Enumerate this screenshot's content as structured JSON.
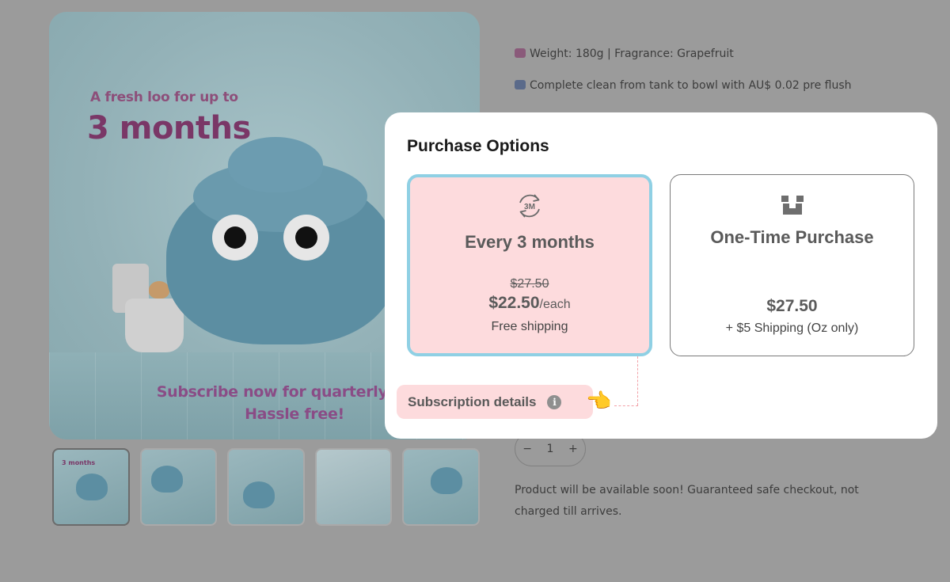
{
  "hero": {
    "pre_title": "A fresh loo for up to",
    "big_title": "3 months",
    "bottom_line1": "Subscribe now for quarterly deliv",
    "bottom_line2": "Hassle free!"
  },
  "thumbnails": {
    "first_caption": "3 months"
  },
  "product": {
    "spec_weight": "Weight: 180g | Fragrance: Grapefruit",
    "spec_clean": "Complete clean from tank to bowl with AU$ 0.02 pre flush",
    "quantity": "1",
    "qty_minus": "−",
    "qty_plus": "+",
    "availability": "Product will be available soon! Guaranteed safe checkout, not charged till arrives."
  },
  "purchase_options": {
    "title": "Purchase Options",
    "subscription": {
      "icon": "refresh-3m-icon",
      "icon_text": "3M",
      "name": "Every 3 months",
      "old_price": "$27.50",
      "price": "$22.50",
      "per": "/each",
      "shipping": "Free shipping",
      "selected": true
    },
    "one_time": {
      "icon": "box-icon",
      "name": "One-Time Purchase",
      "price": "$27.50",
      "shipping": "+ $5 Shipping (Oz only)"
    },
    "details_label": "Subscription details",
    "pointer_icon": "👈"
  },
  "colors": {
    "selected_fill": "#fddbdd",
    "selected_border": "#8fd0e4",
    "connector": "#f2a0a6",
    "overlay": "#9b9b9b"
  }
}
